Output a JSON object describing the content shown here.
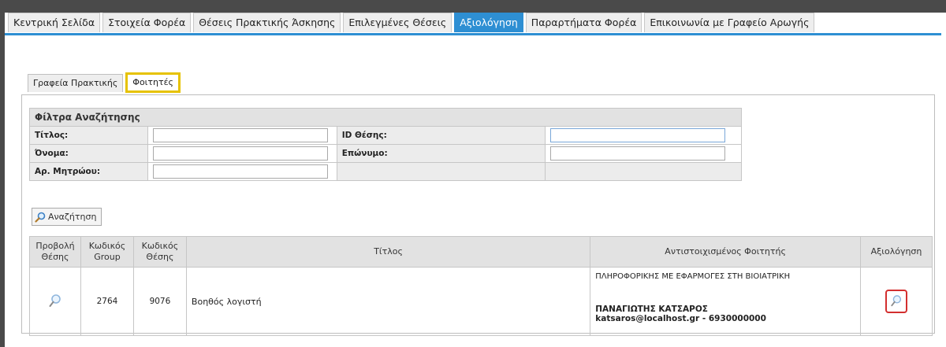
{
  "top_tabs": [
    {
      "label": "Κεντρική Σελίδα",
      "active": false
    },
    {
      "label": "Στοιχεία Φορέα",
      "active": false
    },
    {
      "label": "Θέσεις Πρακτικής Άσκησης",
      "active": false
    },
    {
      "label": "Επιλεγμένες Θέσεις",
      "active": false
    },
    {
      "label": "Αξιολόγηση",
      "active": true
    },
    {
      "label": "Παραρτήματα Φορέα",
      "active": false
    },
    {
      "label": "Επικοινωνία με Γραφείο Αρωγής",
      "active": false
    }
  ],
  "sub_tabs": [
    {
      "label": "Γραφεία Πρακτικής",
      "active": false
    },
    {
      "label": "Φοιτητές",
      "active": true
    }
  ],
  "filters": {
    "header": "Φίλτρα Αναζήτησης",
    "title_label": "Τίτλος:",
    "title_value": "",
    "position_id_label": "ID Θέσης:",
    "position_id_value": "",
    "first_name_label": "Όνομα:",
    "first_name_value": "",
    "last_name_label": "Επώνυμο:",
    "last_name_value": "",
    "registry_label": "Αρ. Μητρώου:",
    "registry_value": ""
  },
  "search_button": "Αναζήτηση",
  "results": {
    "headers": {
      "view_position": [
        "Προβολή",
        "Θέσης"
      ],
      "group_code": [
        "Κωδικός",
        "Group"
      ],
      "position_code": [
        "Κωδικός",
        "Θέσης"
      ],
      "title": "Τίτλος",
      "student": "Αντιστοιχισμένος Φοιτητής",
      "evaluation": "Αξιολόγηση"
    },
    "rows": [
      {
        "group_code": "2764",
        "position_code": "9076",
        "title": "Βοηθός λογιστή",
        "department": "ΠΛΗΡΟΦΟΡΙΚΗΣ ΜΕ ΕΦΑΡΜΟΓΕΣ ΣΤΗ ΒΙΟΙΑΤΡΙΚΗ",
        "student_name": "ΠΑΝΑΓΙΩΤΗΣ ΚΑΤΣΑΡΟΣ",
        "student_contact": "katsaros@localhost.gr  -  6930000000"
      }
    ]
  },
  "colors": {
    "accent": "#2e8fd3",
    "highlight_tab": "#e6c200",
    "highlight_eval": "#d32f2f"
  }
}
